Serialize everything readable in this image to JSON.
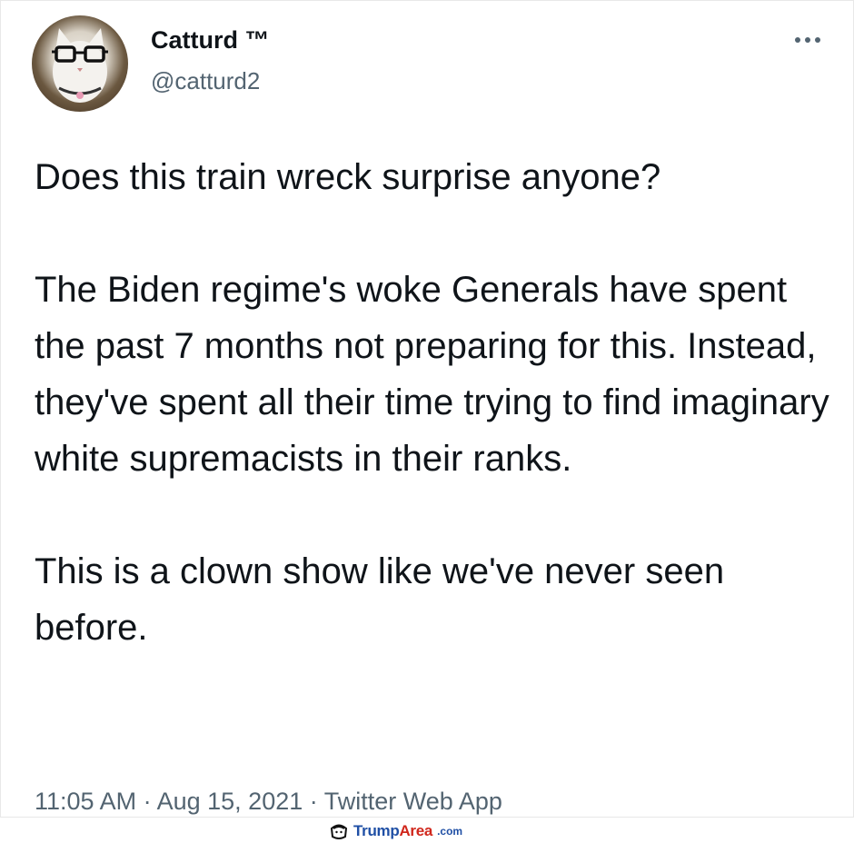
{
  "author": {
    "display_name": "Catturd ™",
    "handle": "@catturd2",
    "avatar_icon": "cat-with-glasses-avatar"
  },
  "more_icon": "more-horizontal-icon",
  "tweet": {
    "paragraphs": [
      "Does this train wreck surprise anyone?",
      "The Biden regime's woke Generals have spent the past 7 months not preparing for this. Instead, they've spent all their time trying to find imaginary white supremacists in their ranks.",
      "This is a clown show like we've never seen before."
    ]
  },
  "meta": {
    "time": "11:05 AM",
    "separator": " · ",
    "date": "Aug 15, 2021",
    "source": "Twitter Web App"
  },
  "watermark": {
    "trump": "Trump",
    "area": "Area",
    "domain": ".com",
    "icon": "trump-logo-icon",
    "colors": {
      "blue": "#1f4fa5",
      "red": "#d0261b"
    }
  }
}
